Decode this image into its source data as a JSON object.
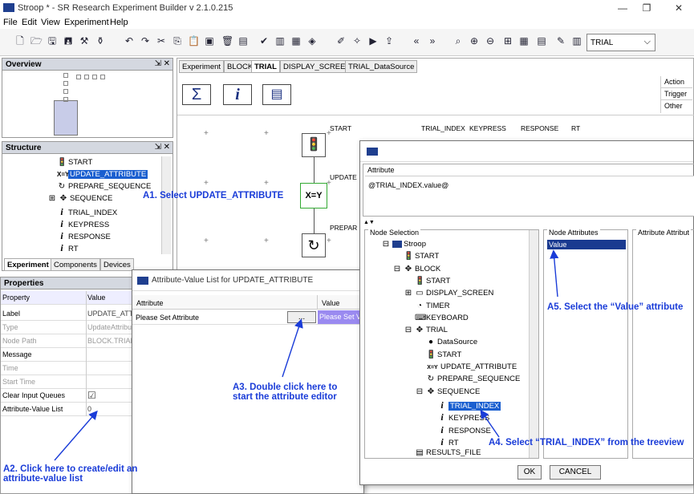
{
  "window": {
    "title": "Stroop * - SR Research Experiment Builder v 2.1.0.215",
    "minimize": "—",
    "maximize": "❐",
    "close": "✕"
  },
  "menu": [
    "File",
    "Edit",
    "View",
    "Experiment",
    "Help"
  ],
  "toolbar": {
    "combo_value": "TRIAL"
  },
  "overview": {
    "title": "Overview"
  },
  "structure": {
    "title": "Structure",
    "items": [
      {
        "label": "START",
        "icon": "traffic-light-icon"
      },
      {
        "label": "UPDATE_ATTRIBUTE",
        "icon": "xy-icon"
      },
      {
        "label": "PREPARE_SEQUENCE",
        "icon": "refresh-icon"
      },
      {
        "label": "SEQUENCE",
        "icon": "sequence-icon"
      },
      {
        "label": "TRIAL_INDEX",
        "icon": "info-icon"
      },
      {
        "label": "KEYPRESS",
        "icon": "info-icon"
      },
      {
        "label": "RESPONSE",
        "icon": "info-icon"
      },
      {
        "label": "RT",
        "icon": "info-icon"
      }
    ],
    "tabs": [
      "Experiment",
      "Components",
      "Devices"
    ]
  },
  "properties": {
    "title": "Properties",
    "col_property": "Property",
    "col_value": "Value",
    "rows": [
      {
        "k": "Label",
        "v": "UPDATE_ATTR"
      },
      {
        "k": "Type",
        "v": "UpdateAttribu"
      },
      {
        "k": "Node Path",
        "v": "BLOCK.TRIAL"
      },
      {
        "k": "Message",
        "v": ""
      },
      {
        "k": "Time",
        "v": ""
      },
      {
        "k": "Start Time",
        "v": ""
      },
      {
        "k": "Clear Input Queues",
        "v": "☑"
      },
      {
        "k": "Attribute-Value List",
        "v": "0"
      }
    ]
  },
  "editor_tabs": [
    "Experiment",
    "BLOCK",
    "TRIAL",
    "DISPLAY_SCREEN",
    "TRIAL_DataSource"
  ],
  "side_tabs": [
    "Action",
    "Trigger",
    "Other"
  ],
  "canvas": {
    "labels": [
      "START",
      "TRIAL_INDEX",
      "KEYPRESS",
      "RESPONSE",
      "RT",
      "UPDATE",
      "PREPAR"
    ]
  },
  "av_dialog": {
    "title": "Attribute-Value List for UPDATE_ATTRIBUTE",
    "col_attribute": "Attribute",
    "col_value": "Value",
    "row_attr": "Please Set Attribute",
    "row_btn": "...",
    "row_value": "Please Set V"
  },
  "attr_dialog": {
    "attribute_label": "Attribute",
    "attribute_value": "@TRIAL_INDEX.value@",
    "node_selection": "Node Selection",
    "node_attributes": "Node Attributes",
    "attribute_attributes": "Attribute Attribut",
    "node_attr_value": "Value",
    "ok": "OK",
    "cancel": "CANCEL",
    "tree": [
      {
        "label": "Stroop",
        "depth": 0,
        "toggle": "⊟",
        "icon": "stroop-icon"
      },
      {
        "label": "START",
        "depth": 1,
        "toggle": "",
        "icon": "traffic-light-icon"
      },
      {
        "label": "BLOCK",
        "depth": 1,
        "toggle": "⊟",
        "icon": "sequence-icon"
      },
      {
        "label": "START",
        "depth": 2,
        "toggle": "",
        "icon": "traffic-light-icon"
      },
      {
        "label": "DISPLAY_SCREEN",
        "depth": 2,
        "toggle": "⊞",
        "icon": "screen-icon"
      },
      {
        "label": "TIMER",
        "depth": 2,
        "toggle": "",
        "icon": "timer-icon"
      },
      {
        "label": "KEYBOARD",
        "depth": 2,
        "toggle": "",
        "icon": "keyboard-icon"
      },
      {
        "label": "TRIAL",
        "depth": 2,
        "toggle": "⊟",
        "icon": "sequence-icon"
      },
      {
        "label": "DataSource",
        "depth": 3,
        "toggle": "",
        "icon": "dot-icon"
      },
      {
        "label": "START",
        "depth": 3,
        "toggle": "",
        "icon": "traffic-light-icon"
      },
      {
        "label": "UPDATE_ATTRIBUTE",
        "depth": 3,
        "toggle": "",
        "icon": "xy-icon"
      },
      {
        "label": "PREPARE_SEQUENCE",
        "depth": 3,
        "toggle": "",
        "icon": "refresh-icon"
      },
      {
        "label": "SEQUENCE",
        "depth": 3,
        "toggle": "⊟",
        "icon": "sequence-icon"
      },
      {
        "label": "TRIAL_INDEX",
        "depth": 4,
        "toggle": "",
        "icon": "info-icon"
      },
      {
        "label": "KEYPRESS",
        "depth": 4,
        "toggle": "",
        "icon": "info-icon"
      },
      {
        "label": "RESPONSE",
        "depth": 4,
        "toggle": "",
        "icon": "info-icon"
      },
      {
        "label": "RT",
        "depth": 4,
        "toggle": "",
        "icon": "info-icon"
      },
      {
        "label": "RESULTS_FILE",
        "depth": 2,
        "toggle": "",
        "icon": "file-icon"
      }
    ]
  },
  "annotations": {
    "a1": "A1. Select UPDATE_ATTRIBUTE",
    "a2": "A2. Click here to create/edit an attribute-value list",
    "a3": "A3. Double click here to start the attribute editor",
    "a4": "A4. Select “TRIAL_INDEX” from the treeview",
    "a5": "A5. Select the “Value” attribute"
  },
  "colors": {
    "annotation": "#1a3cd8",
    "selection": "#1a5fd0"
  }
}
